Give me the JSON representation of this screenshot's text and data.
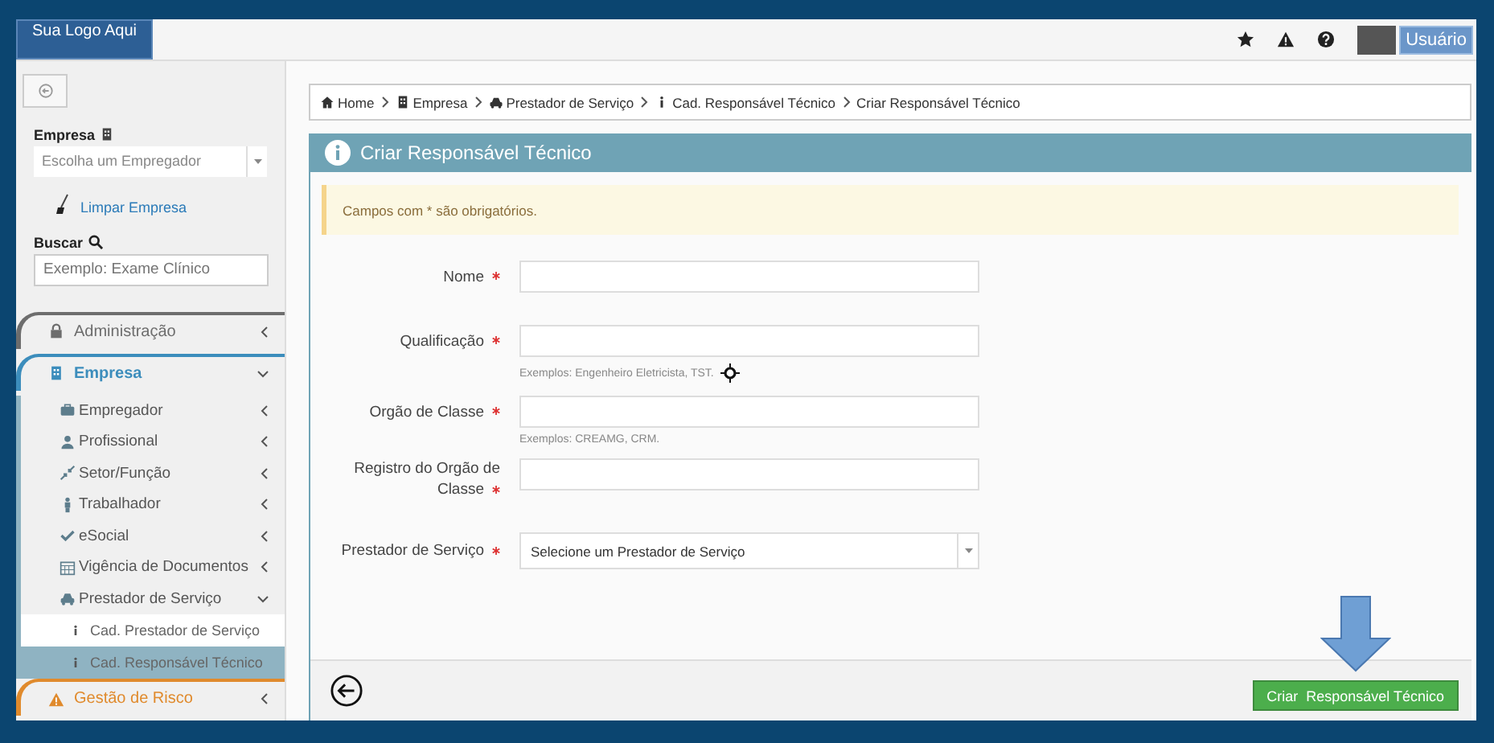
{
  "header": {
    "logo": "Sua Logo Aqui",
    "user_label": "Usuário"
  },
  "sidebar": {
    "company_label": "Empresa",
    "company_select": {
      "placeholder": "Escolha um Empregador"
    },
    "clear_link": "Limpar Empresa",
    "search_label": "Buscar",
    "search": {
      "placeholder": "Exemplo: Exame Clínico"
    },
    "menu": [
      {
        "label": "Administração",
        "color": "#6d6d6d",
        "expanded": false
      },
      {
        "label": "Empresa",
        "color": "#3c8dbc",
        "expanded": true,
        "children": [
          {
            "label": "Empregador",
            "expanded": false
          },
          {
            "label": "Profissional",
            "expanded": false
          },
          {
            "label": "Setor/Função",
            "expanded": false
          },
          {
            "label": "Trabalhador",
            "expanded": false
          },
          {
            "label": "eSocial",
            "expanded": false
          },
          {
            "label": "Vigência de Documentos",
            "expanded": false
          },
          {
            "label": "Prestador de Serviço",
            "expanded": true,
            "children": [
              {
                "label": "Cad. Prestador de Serviço",
                "selected": false
              },
              {
                "label": "Cad. Responsável Técnico",
                "selected": true
              }
            ]
          }
        ]
      },
      {
        "label": "Gestão de Risco",
        "color": "#e08a2c",
        "expanded": false
      }
    ]
  },
  "breadcrumb": [
    "Home",
    "Empresa",
    "Prestador de Serviço",
    "Cad. Responsável Técnico",
    "Criar Responsável Técnico"
  ],
  "panel": {
    "title": "Criar Responsável Técnico",
    "alert": "Campos com * são obrigatórios.",
    "fields": [
      {
        "kind": "text",
        "label": "Nome",
        "required": true
      },
      {
        "kind": "text",
        "label": "Qualificação",
        "required": true,
        "hint": "Exemplos: Engenheiro Eletricista, TST."
      },
      {
        "kind": "text",
        "label": "Orgão de Classe",
        "required": true,
        "hint": "Exemplos: CREAMG, CRM."
      },
      {
        "kind": "text",
        "label": "Registro do Orgão de Classe",
        "required": true
      },
      {
        "kind": "select",
        "label": "Prestador de Serviço",
        "required": true,
        "placeholder": "Selecione um Prestador de Serviço"
      }
    ],
    "submit_button": "Criar  Responsável Técnico"
  }
}
